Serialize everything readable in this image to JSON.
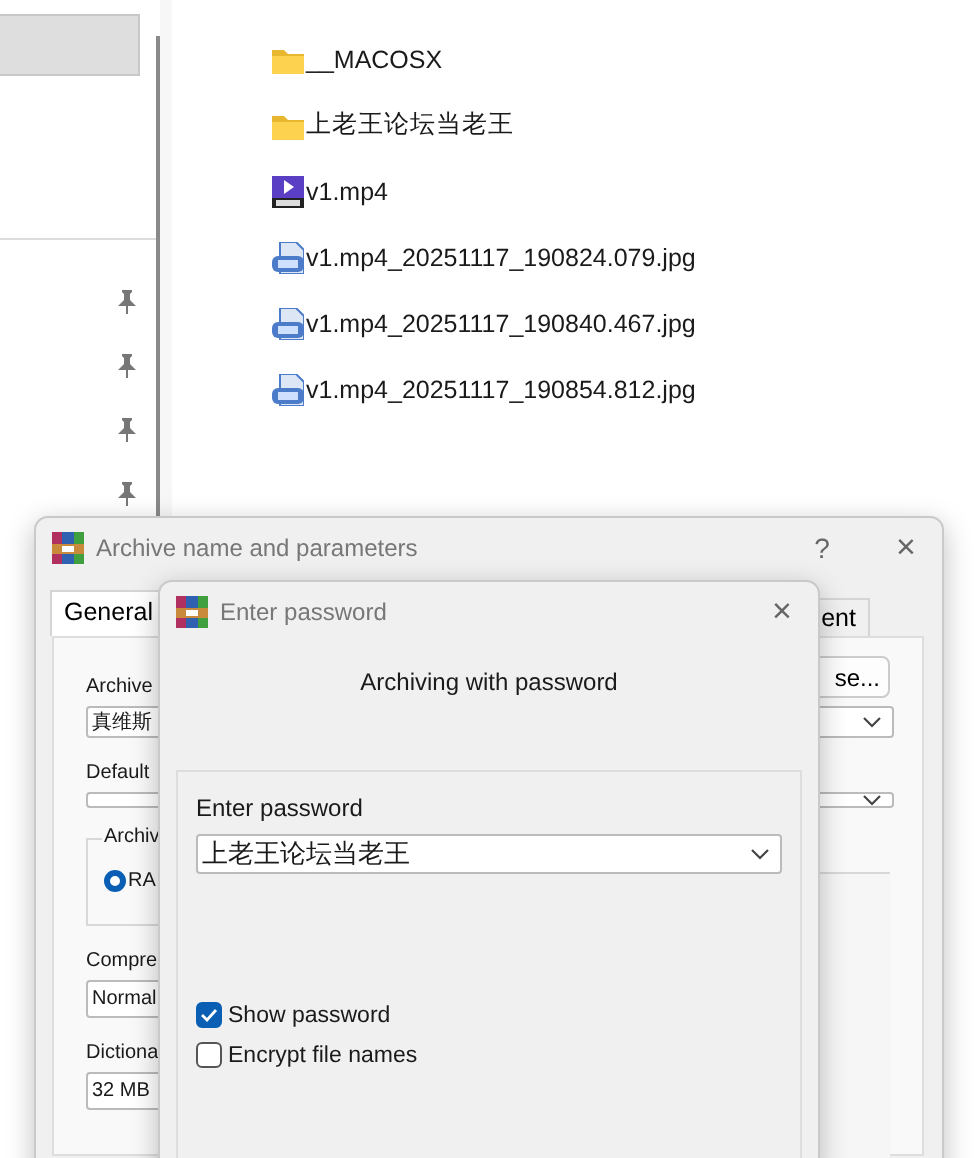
{
  "explorer": {
    "sidebar": {
      "items": [
        {
          "selected": true,
          "pinned": false
        },
        {
          "selected": false,
          "pinned": true
        },
        {
          "selected": false,
          "pinned": true
        },
        {
          "selected": false,
          "pinned": true
        },
        {
          "selected": false,
          "pinned": true
        }
      ]
    },
    "files": [
      {
        "name": "__MACOSX",
        "kind": "folder"
      },
      {
        "name": "上老王论坛当老王",
        "kind": "folder"
      },
      {
        "name": "v1.mp4",
        "kind": "video"
      },
      {
        "name": "v1.mp4_20251117_190824.079.jpg",
        "kind": "image"
      },
      {
        "name": "v1.mp4_20251117_190840.467.jpg",
        "kind": "image"
      },
      {
        "name": "v1.mp4_20251117_190854.812.jpg",
        "kind": "image"
      }
    ]
  },
  "archive_dialog": {
    "title": "Archive name and parameters",
    "help": "?",
    "close": "×",
    "tabs": [
      {
        "label": "General",
        "selected": true
      },
      {
        "label": "ent",
        "selected": false
      }
    ],
    "browse_button": "se...",
    "archive_label": "Archive",
    "archive_value": "真维斯",
    "default_label": "Default",
    "format_group": "Archiv",
    "format_option": {
      "label": "RA",
      "selected": true
    },
    "compression_label": "Compre",
    "compression_value": "Normal",
    "dictionary_label": "Dictiona",
    "dictionary_value": "32 MB"
  },
  "password_dialog": {
    "title": "Enter password",
    "close": "×",
    "heading": "Archiving with password",
    "password_label": "Enter password",
    "password_value": "上老王论坛当老王",
    "options": [
      {
        "label": "Show password",
        "checked": true
      },
      {
        "label": "Encrypt file names",
        "checked": false
      }
    ]
  }
}
